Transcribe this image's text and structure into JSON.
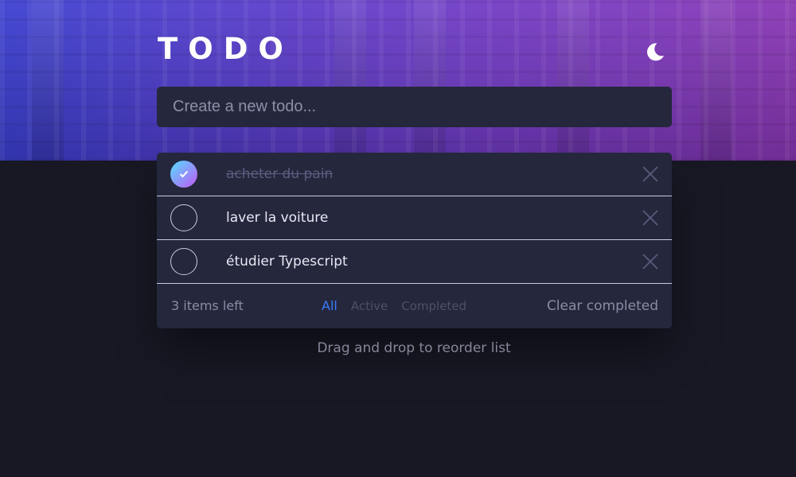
{
  "header": {
    "title": "TODO",
    "theme_icon": "moon-icon"
  },
  "new_todo": {
    "placeholder": "Create a new todo..."
  },
  "todos": [
    {
      "text": "acheter du pain",
      "completed": true
    },
    {
      "text": "laver la voiture",
      "completed": false
    },
    {
      "text": "étudier Typescript",
      "completed": false
    }
  ],
  "footer": {
    "items_left": "3 items left",
    "filters": [
      {
        "label": "All",
        "active": true
      },
      {
        "label": "Active",
        "active": false
      },
      {
        "label": "Completed",
        "active": false
      }
    ],
    "clear_label": "Clear completed"
  },
  "hint": "Drag and drop to reorder list",
  "colors": {
    "accent": "#3a7cfd",
    "background": "#171823",
    "card": "#25273d",
    "check_gradient_start": "#55ddff",
    "check_gradient_end": "#c058f3"
  }
}
